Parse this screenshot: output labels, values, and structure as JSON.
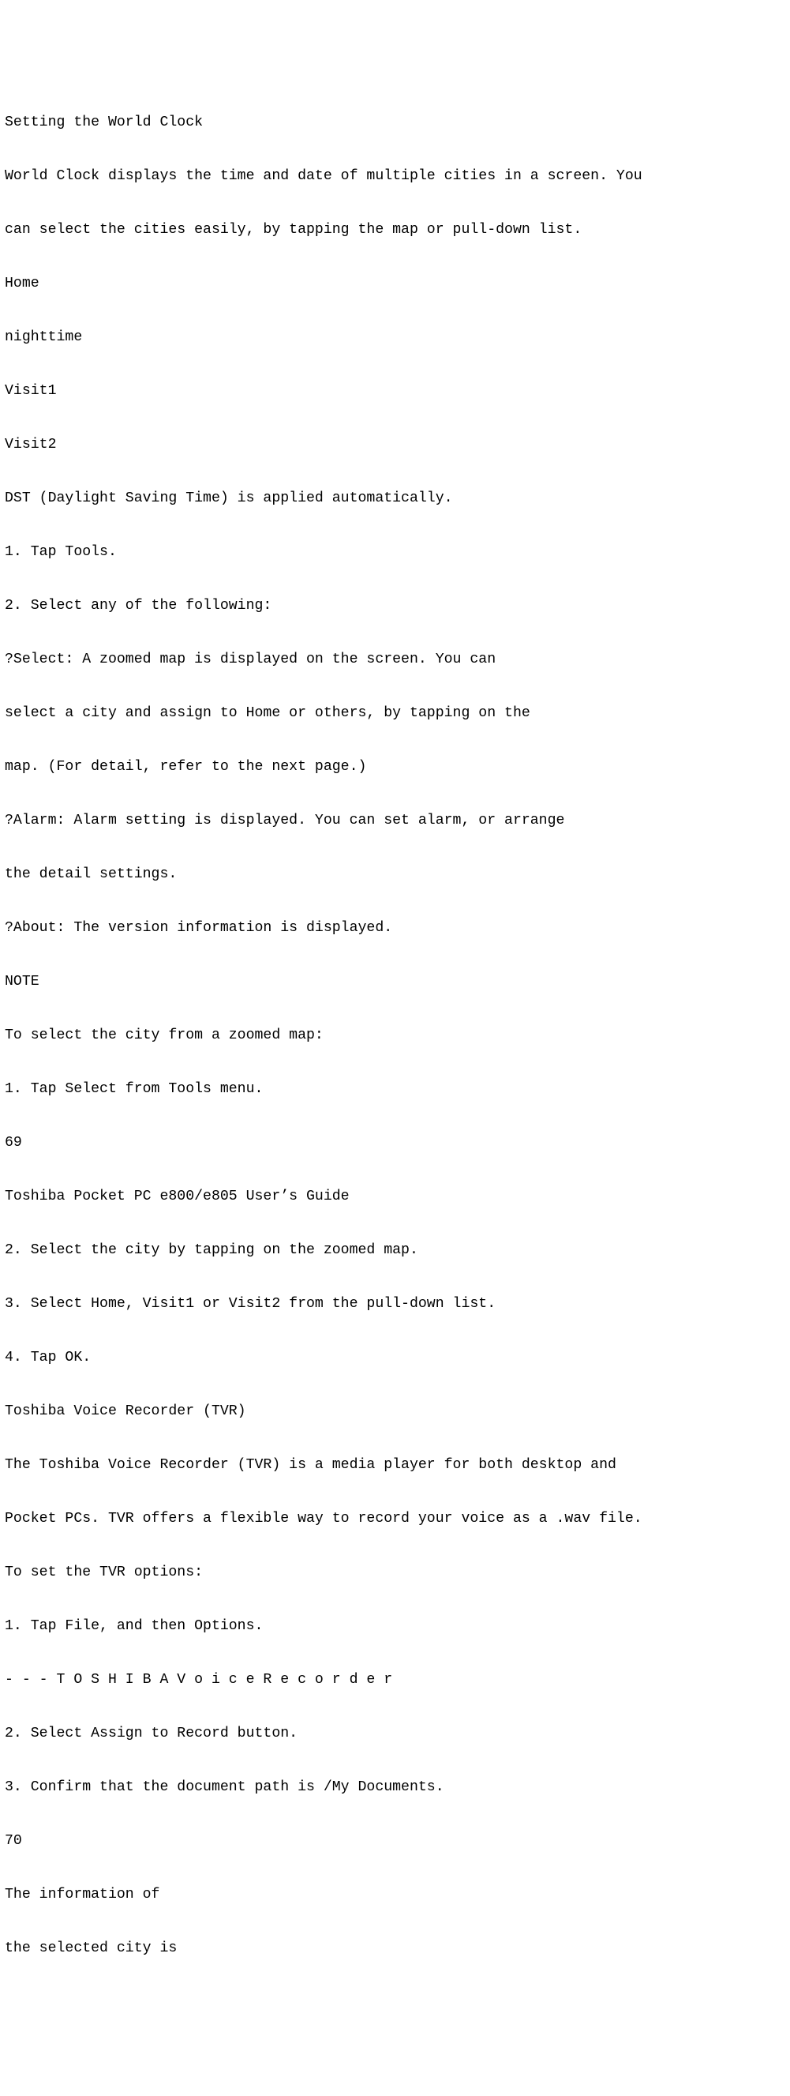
{
  "lines": [
    "Setting the World Clock",
    "World Clock displays the time and date of multiple cities in a screen. You",
    "can select the cities easily, by tapping the map or pull-down list.",
    "Home",
    "nighttime",
    "Visit1",
    "Visit2",
    "DST (Daylight Saving Time) is applied automatically.",
    "1. Tap Tools.",
    "2. Select any of the following:",
    "?Select: A zoomed map is displayed on the screen. You can",
    "select a city and assign to Home or others, by tapping on the",
    "map. (For detail, refer to the next page.)",
    "?Alarm: Alarm setting is displayed. You can set alarm, or arrange",
    "the detail settings.",
    "?About: The version information is displayed.",
    "NOTE",
    "To select the city from a zoomed map:",
    "1. Tap Select from Tools menu.",
    "69",
    "Toshiba Pocket PC e800/e805 User’s Guide",
    "2. Select the city by tapping on the zoomed map.",
    "3. Select Home, Visit1 or Visit2 from the pull-down list.",
    "4. Tap OK.",
    "Toshiba Voice Recorder (TVR)",
    "The Toshiba Voice Recorder (TVR) is a media player for both desktop and",
    "Pocket PCs. TVR offers a flexible way to record your voice as a .wav file.",
    "To set the TVR options:",
    "1. Tap File, and then Options.",
    "- - - T O S H I B A V o i c e R e c o r d e r",
    "2. Select Assign to Record button.",
    "3. Confirm that the document path is /My Documents.",
    "70",
    "The information of",
    "the selected city is"
  ]
}
